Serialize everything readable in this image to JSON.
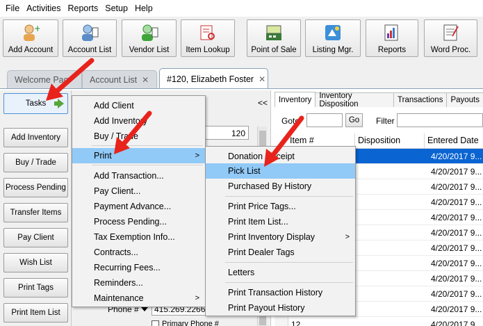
{
  "menubar": [
    "File",
    "Activities",
    "Reports",
    "Setup",
    "Help"
  ],
  "toolbar": [
    {
      "label": "Add Account",
      "icon": "add-account-icon"
    },
    {
      "label": "Account List",
      "icon": "account-list-icon"
    },
    {
      "label": "Vendor List",
      "icon": "vendor-list-icon"
    },
    {
      "label": "Item Lookup",
      "icon": "item-lookup-icon"
    },
    {
      "label": "Point of Sale",
      "icon": "point-of-sale-icon"
    },
    {
      "label": "Listing Mgr.",
      "icon": "listing-manager-icon"
    },
    {
      "label": "Reports",
      "icon": "reports-icon"
    },
    {
      "label": "Word Proc.",
      "icon": "word-processor-icon"
    }
  ],
  "tabs": [
    {
      "label": "Welcome Pag",
      "closable": false
    },
    {
      "label": "Account List",
      "closable": true
    },
    {
      "label": "#120, Elizabeth Foster",
      "closable": true
    }
  ],
  "left_buttons": [
    "Tasks",
    "Add Inventory",
    "Buy / Trade",
    "Process Pending",
    "Transfer Items",
    "Pay Client",
    "Wish List",
    "Print Tags",
    "Print Item List"
  ],
  "mid": {
    "collapse": "<<",
    "account_number": "120",
    "phone_label": "Phone #",
    "phone_value": "415.269.2266",
    "primary_phone": "Primary Phone #"
  },
  "right": {
    "tabs": [
      "Inventory",
      "Inventory Disposition",
      "Transactions",
      "Payouts"
    ],
    "goto_label": "Goto",
    "go_button": "Go",
    "filter_label": "Filter",
    "columns": [
      "Item #",
      "Disposition",
      "Entered Date"
    ],
    "rows": [
      {
        "date": "4/20/2017 9..."
      },
      {
        "date": "4/20/2017 9..."
      },
      {
        "date": "4/20/2017 9..."
      },
      {
        "date": "4/20/2017 9..."
      },
      {
        "date": "4/20/2017 9..."
      },
      {
        "date": "4/20/2017 9..."
      },
      {
        "date": "4/20/2017 9..."
      },
      {
        "date": "4/20/2017 9..."
      },
      {
        "date": "4/20/2017 9..."
      },
      {
        "date": "4/20/2017 9..."
      },
      {
        "date": "4/20/2017 9..."
      },
      {
        "date": "4/20/2017 9..."
      }
    ],
    "last_row_id": "12"
  },
  "tasks_menu": [
    {
      "label": "Add Client"
    },
    {
      "label": "Add Inventory"
    },
    {
      "label": "Buy / Trade"
    },
    {
      "label": "Print",
      "submenu": true,
      "highlight": true
    },
    {
      "label": "Add Transaction..."
    },
    {
      "label": "Pay Client..."
    },
    {
      "label": "Payment Advance..."
    },
    {
      "label": "Process Pending..."
    },
    {
      "label": "Tax Exemption Info..."
    },
    {
      "label": "Contracts..."
    },
    {
      "label": "Recurring Fees..."
    },
    {
      "label": "Reminders..."
    },
    {
      "label": "Maintenance",
      "submenu": true
    }
  ],
  "print_menu": [
    {
      "label": "Donation Receipt"
    },
    {
      "label": "Pick List",
      "highlight": true
    },
    {
      "label": "Purchased By History"
    },
    {
      "label": "Print Price Tags..."
    },
    {
      "label": "Print Item List..."
    },
    {
      "label": "Print Inventory Display",
      "submenu": true
    },
    {
      "label": "Print Dealer Tags"
    },
    {
      "label": "Letters"
    },
    {
      "label": "Print Transaction History"
    },
    {
      "label": "Print Payout History"
    }
  ],
  "colors": {
    "accent": "#0a64d2",
    "menu_highlight": "#91c9f7",
    "arrow": "#e8231b"
  }
}
